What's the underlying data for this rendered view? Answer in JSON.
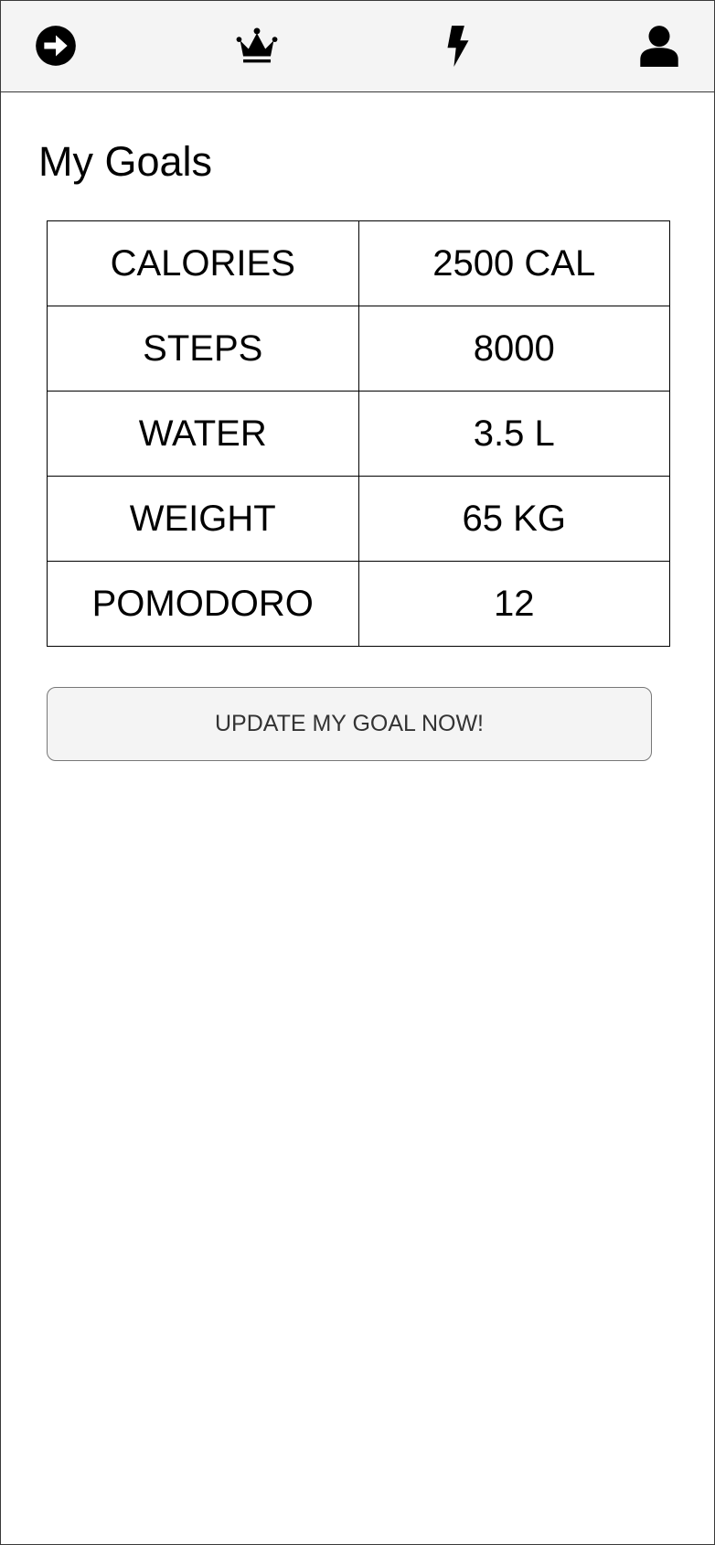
{
  "nav": {
    "items": [
      {
        "icon": "arrow-right-circle-icon"
      },
      {
        "icon": "crown-icon"
      },
      {
        "icon": "lightning-bolt-icon"
      },
      {
        "icon": "user-icon"
      }
    ]
  },
  "page": {
    "title": "My Goals"
  },
  "goals": {
    "rows": [
      {
        "label": "CALORIES",
        "value": "2500 CAL"
      },
      {
        "label": "STEPS",
        "value": "8000"
      },
      {
        "label": "WATER",
        "value": "3.5 L"
      },
      {
        "label": "WEIGHT",
        "value": "65 KG"
      },
      {
        "label": "POMODORO",
        "value": "12"
      }
    ]
  },
  "actions": {
    "update_label": "UPDATE MY GOAL NOW!"
  }
}
